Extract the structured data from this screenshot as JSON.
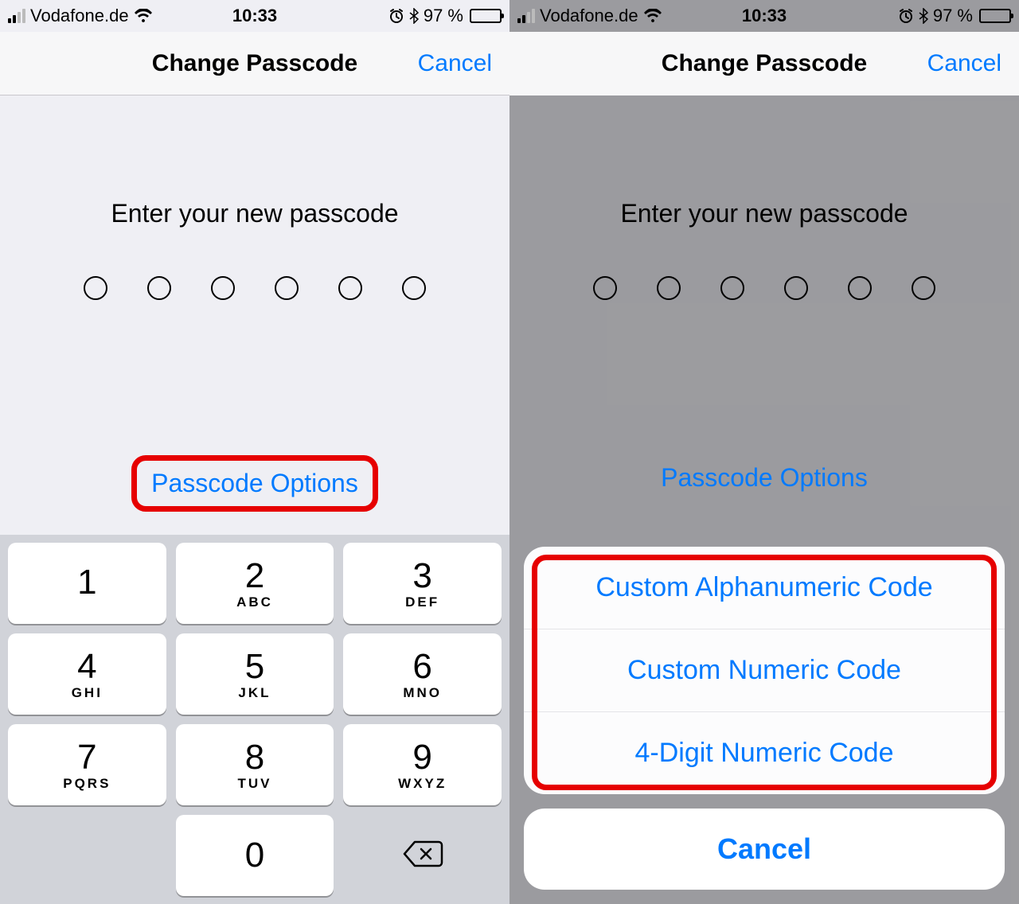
{
  "status": {
    "carrier": "Vodafone.de",
    "time": "10:33",
    "battery_pct": "97 %"
  },
  "nav": {
    "title": "Change Passcode",
    "cancel": "Cancel"
  },
  "prompt": "Enter your new passcode",
  "passcode_digits": 6,
  "options_link": "Passcode Options",
  "keypad": [
    {
      "num": "1",
      "letters": ""
    },
    {
      "num": "2",
      "letters": "ABC"
    },
    {
      "num": "3",
      "letters": "DEF"
    },
    {
      "num": "4",
      "letters": "GHI"
    },
    {
      "num": "5",
      "letters": "JKL"
    },
    {
      "num": "6",
      "letters": "MNO"
    },
    {
      "num": "7",
      "letters": "PQRS"
    },
    {
      "num": "8",
      "letters": "TUV"
    },
    {
      "num": "9",
      "letters": "WXYZ"
    },
    {
      "num": "0",
      "letters": ""
    }
  ],
  "sheet": {
    "options": [
      "Custom Alphanumeric Code",
      "Custom Numeric Code",
      "4-Digit Numeric Code"
    ],
    "cancel": "Cancel"
  },
  "colors": {
    "ios_blue": "#007aff",
    "highlight_red": "#e60000"
  }
}
